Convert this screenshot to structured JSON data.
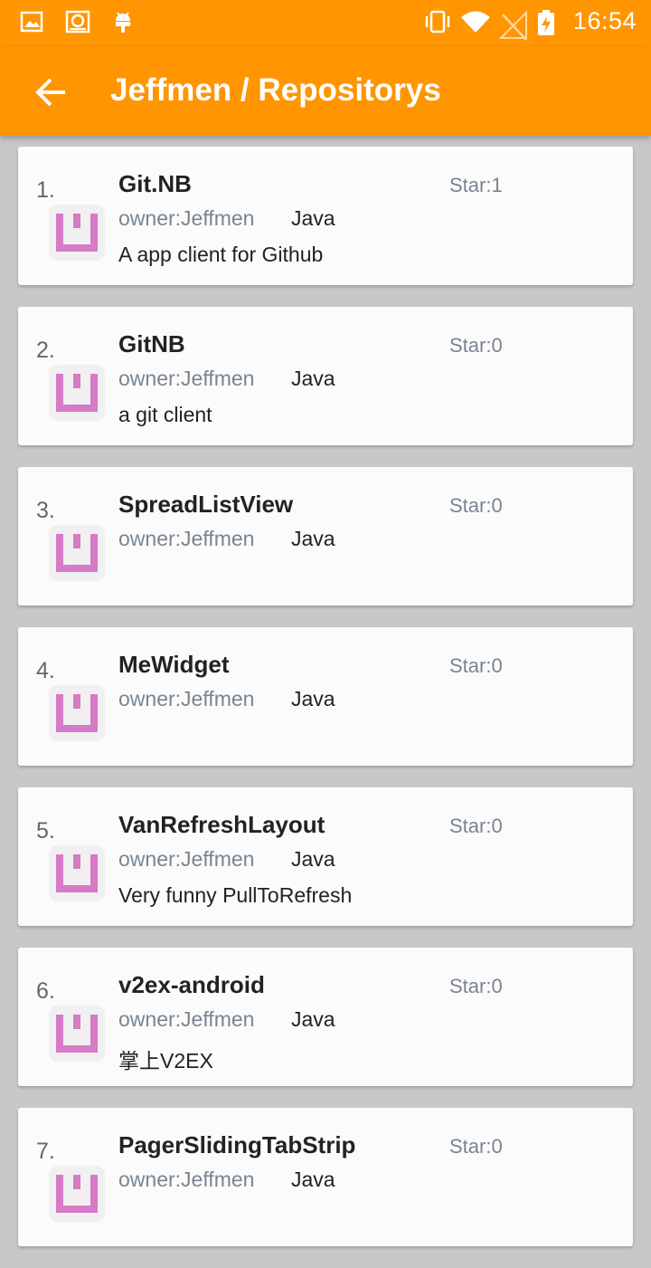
{
  "status_bar": {
    "time": "16:54",
    "left_icons": [
      "image-icon",
      "sync-icon",
      "android-icon"
    ],
    "right_icons": [
      "vibrate-icon",
      "wifi-icon",
      "no-signal-icon",
      "battery-charging-icon"
    ]
  },
  "app_bar": {
    "title": "Jeffmen / Repositorys",
    "color": "#ff9500"
  },
  "repos": [
    {
      "index": "1.",
      "name": "Git.NB",
      "owner": "owner:Jeffmen",
      "language": "Java",
      "description": "A app client for Github",
      "stars": "Star:1"
    },
    {
      "index": "2.",
      "name": "GitNB",
      "owner": "owner:Jeffmen",
      "language": "Java",
      "description": "a git client",
      "stars": "Star:0"
    },
    {
      "index": "3.",
      "name": "SpreadListView",
      "owner": "owner:Jeffmen",
      "language": "Java",
      "description": "",
      "stars": "Star:0"
    },
    {
      "index": "4.",
      "name": "MeWidget",
      "owner": "owner:Jeffmen",
      "language": "Java",
      "description": "",
      "stars": "Star:0"
    },
    {
      "index": "5.",
      "name": "VanRefreshLayout",
      "owner": "owner:Jeffmen",
      "language": "Java",
      "description": "Very funny PullToRefresh",
      "stars": "Star:0"
    },
    {
      "index": "6.",
      "name": "v2ex-android",
      "owner": "owner:Jeffmen",
      "language": "Java",
      "description": "掌上V2EX",
      "stars": "Star:0"
    },
    {
      "index": "7.",
      "name": "PagerSlidingTabStrip",
      "owner": "owner:Jeffmen",
      "language": "Java",
      "description": "",
      "stars": "Star:0"
    }
  ],
  "colors": {
    "accent": "#ff9500",
    "avatar": "#d77ac7",
    "muted_text": "#7a8590"
  }
}
